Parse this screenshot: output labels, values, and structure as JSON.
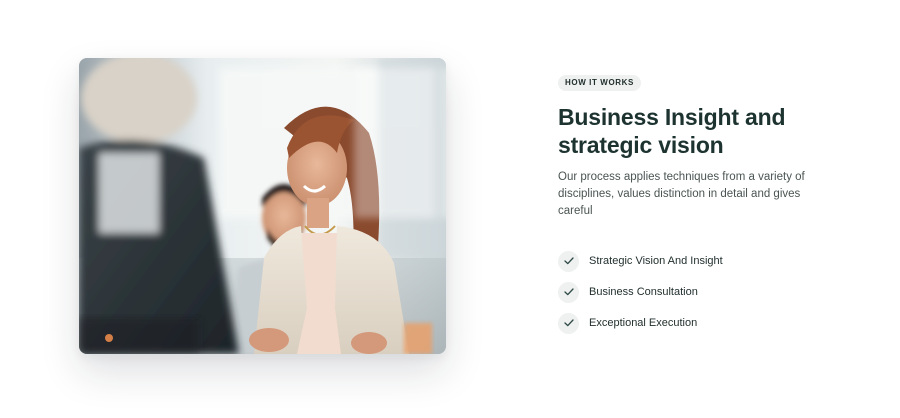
{
  "section": {
    "badge": "HOW IT WORKS",
    "title": "Business Insight and strategic vision",
    "description": "Our process applies techniques from a variety of disciplines, values distinction in detail and gives careful",
    "features": [
      {
        "label": "Strategic Vision And Insight",
        "icon": "check-icon"
      },
      {
        "label": "Business Consultation",
        "icon": "check-icon"
      },
      {
        "label": "Exceptional Execution",
        "icon": "check-icon"
      }
    ]
  },
  "image": {
    "subject": "team-meeting-photo"
  },
  "colors": {
    "heading": "#1d3330",
    "body": "#4a5553",
    "badge_bg": "#eef1f0",
    "check_bg": "#eef1f0",
    "check_stroke": "#2f4a46"
  }
}
